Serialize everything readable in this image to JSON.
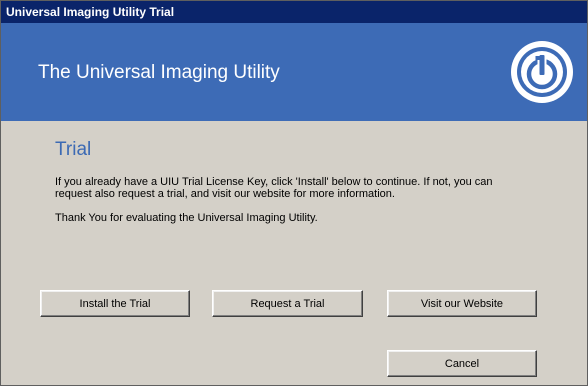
{
  "window": {
    "title": "Universal Imaging Utility Trial"
  },
  "banner": {
    "title": "The Universal Imaging Utility",
    "logo_icon": "power-button-icon",
    "color": "#3d6bb6"
  },
  "main": {
    "heading": "Trial",
    "body": "If you already have a UIU Trial License Key, click 'Install' below to continue. If not, you can request also request a trial, and visit our website for more information.",
    "thanks": "Thank You for evaluating the Universal Imaging Utility."
  },
  "buttons": {
    "install": "Install the Trial",
    "request": "Request a Trial",
    "website": "Visit our Website",
    "cancel": "Cancel"
  }
}
